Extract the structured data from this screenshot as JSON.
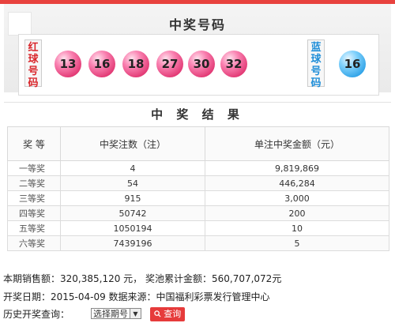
{
  "winning_numbers": {
    "title": "中奖号码",
    "red_label": [
      "红",
      "球",
      "号",
      "码"
    ],
    "blue_label": [
      "蓝",
      "球",
      "号",
      "码"
    ],
    "red_balls": [
      "13",
      "16",
      "18",
      "27",
      "30",
      "32"
    ],
    "blue_ball": "16",
    "colors": {
      "red_ball": "#e0336f",
      "blue_ball": "#2ba0e6",
      "red_tag_text": "#d9262b",
      "blue_tag_text": "#1f8ed8",
      "top_bar": "#e8423e"
    }
  },
  "results": {
    "title": "中 奖 结 果",
    "headers": [
      "奖  等",
      "中奖注数（注）",
      "单注中奖金额（元）"
    ],
    "rows": [
      {
        "level": "一等奖",
        "count": "4",
        "amount": "9,819,869"
      },
      {
        "level": "二等奖",
        "count": "54",
        "amount": "446,284"
      },
      {
        "level": "三等奖",
        "count": "915",
        "amount": "3,000"
      },
      {
        "level": "四等奖",
        "count": "50742",
        "amount": "200"
      },
      {
        "level": "五等奖",
        "count": "1050194",
        "amount": "10"
      },
      {
        "level": "六等奖",
        "count": "7439196",
        "amount": "5"
      }
    ]
  },
  "footer": {
    "sales_line": "本期销售额：320,385,120 元， 奖池累计金额：560,707,072元",
    "date_line": "开奖日期：2015-04-09 数据来源：中国福利彩票发行管理中心",
    "history_label": "历史开奖查询：",
    "select_value": "选择期号",
    "select_arrow": "▼",
    "query_icon": "search-icon",
    "query_label": "查询"
  }
}
